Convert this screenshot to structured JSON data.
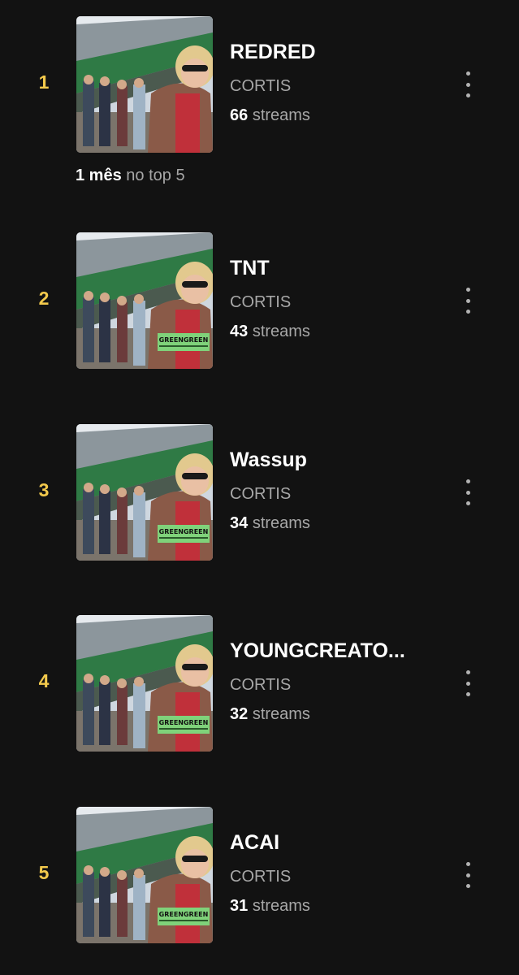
{
  "tracks": [
    {
      "rank": "1",
      "title": "REDRED",
      "artist": "CORTIS",
      "streams_count": "66",
      "streams_label": "streams",
      "cover_text": ""
    },
    {
      "rank": "2",
      "title": "TNT",
      "artist": "CORTIS",
      "streams_count": "43",
      "streams_label": "streams",
      "cover_text": "GREENGREEN"
    },
    {
      "rank": "3",
      "title": "Wassup",
      "artist": "CORTIS",
      "streams_count": "34",
      "streams_label": "streams",
      "cover_text": "GREENGREEN"
    },
    {
      "rank": "4",
      "title": "YOUNGCREATO...",
      "artist": "CORTIS",
      "streams_count": "32",
      "streams_label": "streams",
      "cover_text": "GREENGREEN"
    },
    {
      "rank": "5",
      "title": "ACAI",
      "artist": "CORTIS",
      "streams_count": "31",
      "streams_label": "streams",
      "cover_text": "GREENGREEN"
    }
  ],
  "top5_note": {
    "duration": "1 mês",
    "label": "no top 5"
  },
  "colors": {
    "background": "#121212",
    "rank": "#f2c94c",
    "secondary_text": "#a7a7a7",
    "cover_label_bg": "#7fd27a"
  },
  "icons": {
    "more": "vertical-ellipsis-icon"
  }
}
